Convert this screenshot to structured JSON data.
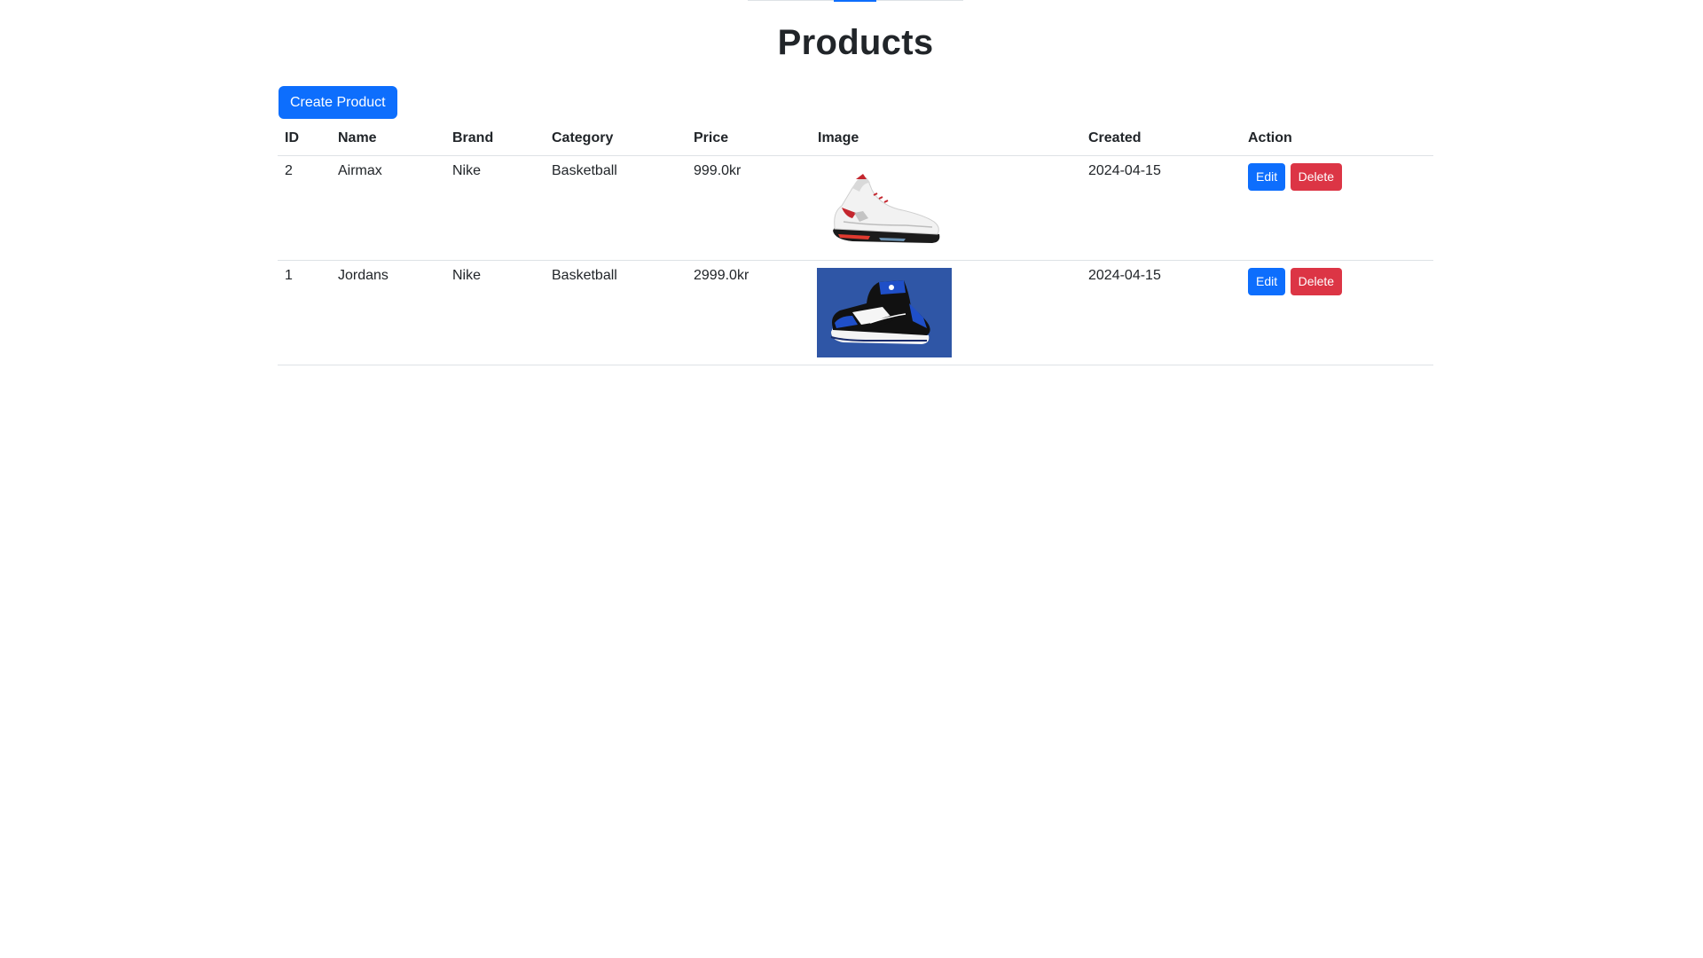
{
  "page": {
    "title": "Products"
  },
  "toolbar": {
    "create_label": "Create Product"
  },
  "table": {
    "headers": [
      "ID",
      "Name",
      "Brand",
      "Category",
      "Price",
      "Image",
      "Created",
      "Action"
    ],
    "rows": [
      {
        "id": "2",
        "name": "Airmax",
        "brand": "Nike",
        "category": "Basketball",
        "price": "999.0kr",
        "image": "white-red-sneaker",
        "created": "2024-04-15",
        "edit_label": "Edit",
        "delete_label": "Delete"
      },
      {
        "id": "1",
        "name": "Jordans",
        "brand": "Nike",
        "category": "Basketball",
        "price": "2999.0kr",
        "image": "blue-black-sneaker",
        "created": "2024-04-15",
        "edit_label": "Edit",
        "delete_label": "Delete"
      }
    ]
  },
  "colors": {
    "primary": "#0d6efd",
    "danger": "#dc3545",
    "border": "#dee2e6",
    "text": "#212529",
    "image_bg_blue": "#2f56a6"
  }
}
